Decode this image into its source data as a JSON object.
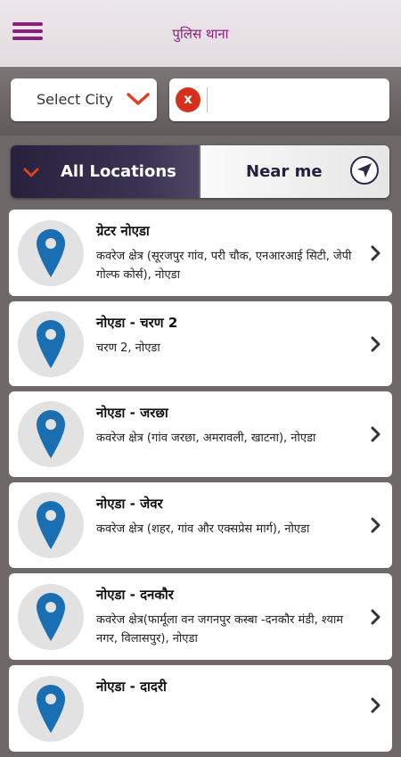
{
  "header": {
    "title": "पुलिस थाना",
    "menu_icon": "hamburger-menu-icon"
  },
  "filters": {
    "city_select_label": "Select City",
    "search_value": "",
    "clear_label": "x"
  },
  "tabs": [
    {
      "label": "All Locations",
      "selected": true
    },
    {
      "label": "Near me",
      "selected": false
    }
  ],
  "colors": {
    "brand": "#8a1d7e",
    "accent": "#d6301d",
    "pin": "#1a6fb3",
    "tab_dark": "#302a47"
  },
  "locations": [
    {
      "title": "ग्रेटर नोएडा",
      "subtitle": "कवरेज क्षेत्र (सूरजपुर गांव, परी चौक, एनआरआई सिटी, जेपी गोल्फ कोर्स), नोएडा"
    },
    {
      "title": "नोएडा - चरण 2",
      "subtitle": "चरण 2, नोएडा"
    },
    {
      "title": "नोएडा - जरछा",
      "subtitle": "कवरेज क्षेत्र (गांव जरछा, अमरावली, खाटना), नोएडा"
    },
    {
      "title": "नोएडा - जेवर",
      "subtitle": "कवरेज क्षेत्र (शहर, गांव और एक्सप्रेस मार्ग), नोएडा"
    },
    {
      "title": "नोएडा - दनकौर",
      "subtitle": "कवरेज क्षेत्र(फार्मूला वन जगनपुर कस्बा -दनकौर मंडी, श्याम नगर, विलासपुर), नोएडा"
    },
    {
      "title": "नोएडा - दादरी",
      "subtitle": ""
    }
  ]
}
